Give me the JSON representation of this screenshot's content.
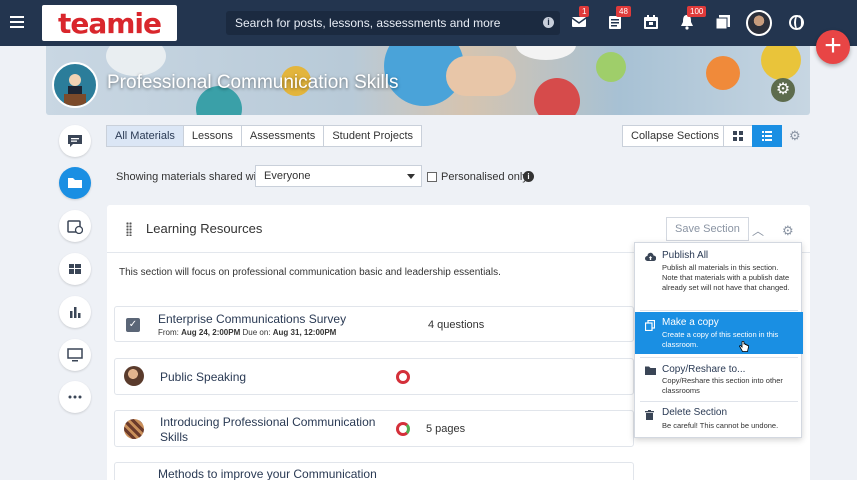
{
  "header": {
    "logo_text": "teamie",
    "search_placeholder": "Search for posts, lessons, assessments and more",
    "badges": {
      "messages": "1",
      "posts": "48",
      "notifications": "100"
    }
  },
  "banner": {
    "title": "Professional Communication Skills"
  },
  "tabs": [
    {
      "label": "All Materials",
      "active": true
    },
    {
      "label": "Lessons",
      "active": false
    },
    {
      "label": "Assessments",
      "active": false
    },
    {
      "label": "Student Projects",
      "active": false
    }
  ],
  "toolbar": {
    "collapse_label": "Collapse Sections"
  },
  "filter": {
    "label": "Showing materials shared with",
    "selected": "Everyone",
    "personalised_label": "Personalised only"
  },
  "section": {
    "title": "Learning Resources",
    "save_label": "Save Section",
    "description": "This section will focus on professional communication basic and leadership essentials."
  },
  "materials": [
    {
      "title": "Enterprise Communications Survey",
      "from_label": "From:",
      "from": "Aug 24, 2:00PM",
      "due_label": "Due on:",
      "due": "Aug 31, 12:00PM",
      "meta": "4 questions"
    },
    {
      "title": "Public Speaking",
      "meta": ""
    },
    {
      "title": "Introducing Professional Communication",
      "title2": "Skills",
      "meta": "5 pages"
    },
    {
      "title": "Methods to improve your Communication",
      "meta": ""
    }
  ],
  "menu": [
    {
      "title": "Publish All",
      "desc": "Publish all materials in this section. Note that materials with a publish date already set will not have that changed."
    },
    {
      "title": "Make a copy",
      "desc": "Create a copy of this section in this classroom."
    },
    {
      "title": "Copy/Reshare to...",
      "desc": "Copy/Reshare this section into other classrooms"
    },
    {
      "title": "Delete Section",
      "desc": "Be careful! This cannot be undone."
    }
  ],
  "icons": {
    "menu": "hamburger-icon",
    "mail": "mail-icon",
    "posts": "posts-icon",
    "calendar": "calendar-icon",
    "bell": "bell-icon",
    "pages": "pages-icon",
    "globe": "globe-icon",
    "add": "plus-icon"
  },
  "colors": {
    "nav": "#23354f",
    "accent": "#1a8fe3",
    "fab": "#e84545",
    "logo": "#d9262c"
  }
}
